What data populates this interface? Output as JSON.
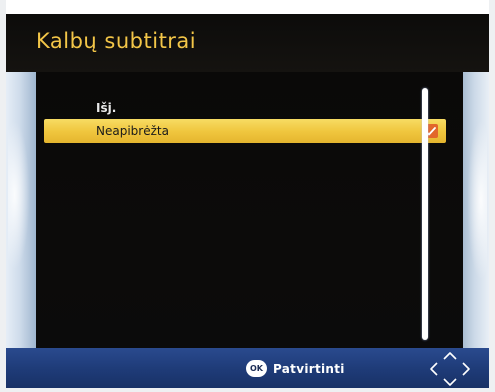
{
  "screen": {
    "title": "Kalbų subtitrai"
  },
  "options": [
    {
      "label": "Išj.",
      "selected": false,
      "checked": false
    },
    {
      "label": "Neapibrėžta",
      "selected": true,
      "checked": true
    }
  ],
  "footer": {
    "ok_badge": "OK",
    "ok_label": "Patvirtinti",
    "nav_icon": "directional-arrows-icon"
  },
  "colors": {
    "title": "#f3c648",
    "highlight": "#f0c73f",
    "checkbox": "#e2672a",
    "footer": "#1f3c79"
  }
}
